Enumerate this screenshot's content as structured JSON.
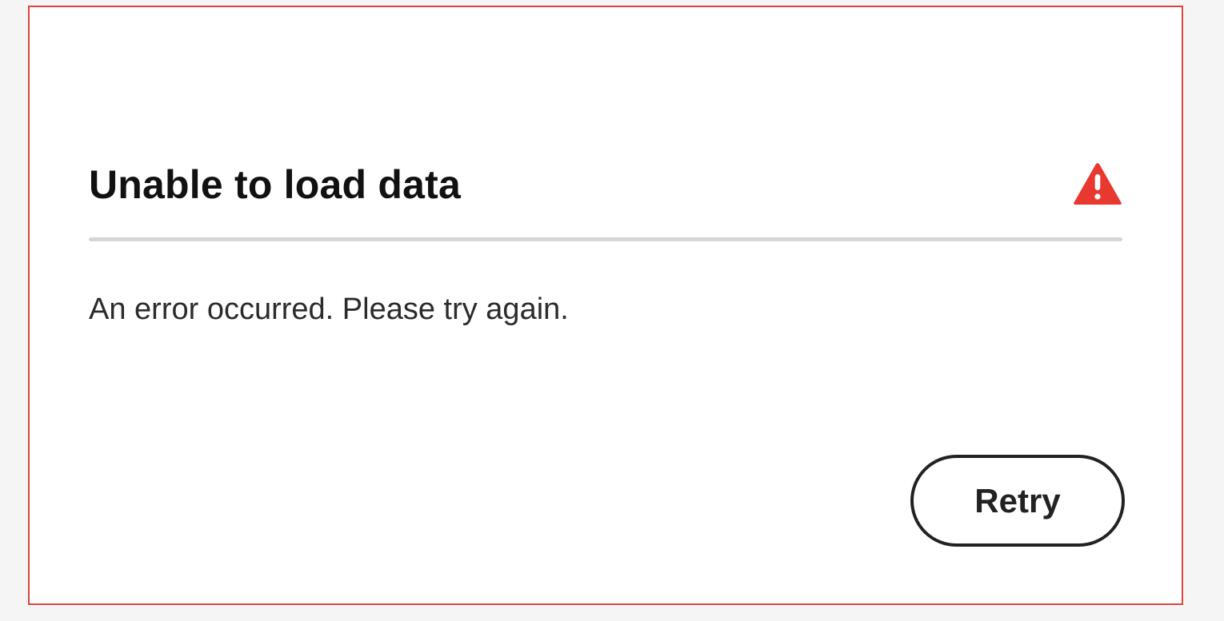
{
  "dialog": {
    "title": "Unable to load data",
    "message": "An error occurred. Please try again.",
    "retry_label": "Retry",
    "icon": "alert-triangle-icon"
  },
  "colors": {
    "page_background": "#f5f5f5",
    "dialog_border": "#d9463f",
    "alert_icon": "#e8382f",
    "divider": "#d6d6d6",
    "text": "#111111",
    "button_border": "#222222"
  }
}
